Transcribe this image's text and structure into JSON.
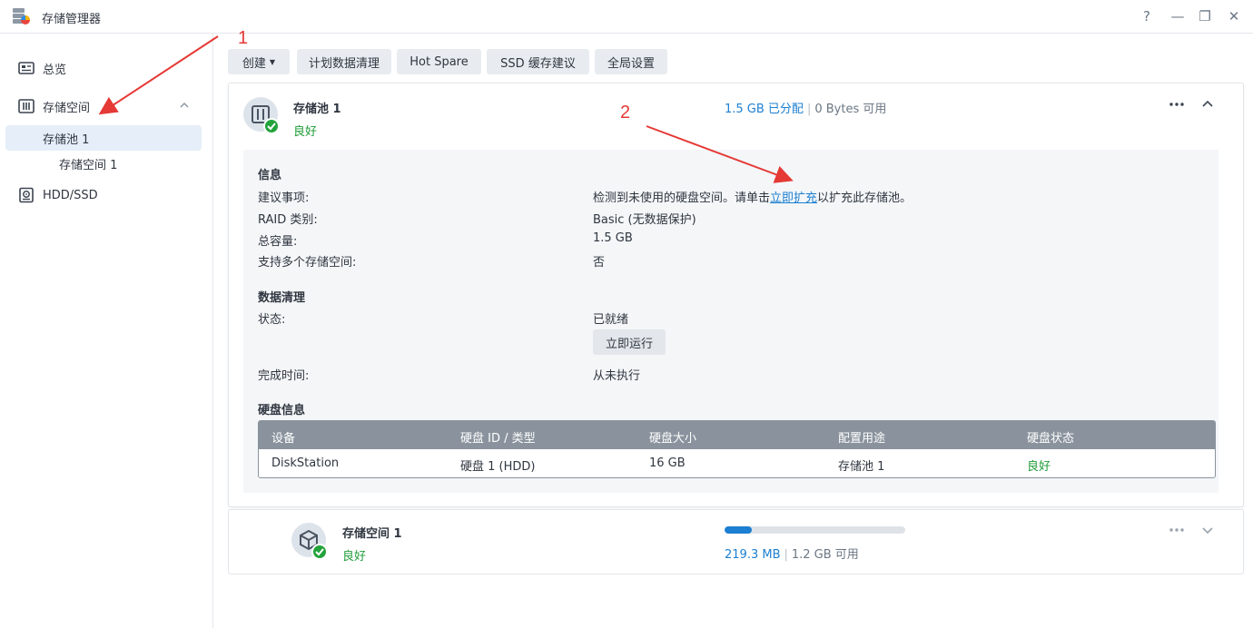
{
  "window": {
    "title": "存储管理器",
    "controls": [
      "?",
      "—",
      "❐",
      "✕"
    ]
  },
  "sidebar": {
    "overview": "总览",
    "storage": "存储空间",
    "pool": "存储池 1",
    "volume": "存储空间 1",
    "hdd": "HDD/SSD"
  },
  "toolbar": {
    "create": "创建",
    "scrub": "计划数据清理",
    "hotspare": "Hot Spare",
    "ssd_cache": "SSD 缓存建议",
    "global": "全局设置"
  },
  "pool": {
    "name": "存储池 1",
    "status": "良好",
    "allocated": "1.5 GB 已分配",
    "available": "0 Bytes 可用",
    "info_title": "信息",
    "suggest_label": "建议事项:",
    "suggest_pre": "检测到未使用的硬盘空间。请单击",
    "suggest_link": "立即扩充",
    "suggest_post": "以扩充此存储池。",
    "raid_label": "RAID 类别:",
    "raid_value": "Basic (无数据保护)",
    "capacity_label": "总容量:",
    "capacity_value": "1.5 GB",
    "multi_label": "支持多个存储空间:",
    "multi_value": "否",
    "scrub_title": "数据清理",
    "scrub_status_label": "状态:",
    "scrub_status_value": "已就绪",
    "run_now": "立即运行",
    "finish_label": "完成时间:",
    "finish_value": "从未执行",
    "disk_title": "硬盘信息"
  },
  "disk_table": {
    "headers": [
      "设备",
      "硬盘 ID / 类型",
      "硬盘大小",
      "配置用途",
      "硬盘状态"
    ],
    "rows": [
      [
        "DiskStation",
        "硬盘 1 (HDD)",
        "16 GB",
        "存储池 1",
        "良好"
      ]
    ]
  },
  "volume": {
    "name": "存储空间 1",
    "status": "良好",
    "used": "219.3 MB",
    "available": "1.2 GB 可用",
    "usage_fraction": 0.15
  },
  "annotations": {
    "one": "1",
    "two": "2"
  },
  "colors": {
    "accent": "#1c7fd1",
    "good": "#1f9d37",
    "annotation": "#e53935"
  }
}
